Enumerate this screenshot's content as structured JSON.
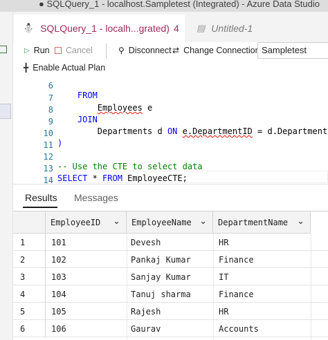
{
  "window": {
    "title": "● SQLQuery_1 - localhost.Sampletest (Integrated) - Azure Data Studio"
  },
  "tabs": [
    {
      "label": "SQLQuery_1 - localh...grated)",
      "count": "4",
      "active": true,
      "icon": "database-icon"
    },
    {
      "label": "Untitled-1",
      "active": false,
      "icon": "file-icon"
    }
  ],
  "toolbar": {
    "run_label": "Run",
    "cancel_label": "Cancel",
    "disconnect_label": "Disconnect",
    "change_connection_label": "Change Connection",
    "database_value": "Sampletest",
    "enable_plan_label": "Enable Actual Plan"
  },
  "editor": {
    "lines": [
      {
        "num": "6",
        "text": "    FROM"
      },
      {
        "num": "7",
        "text": "        Employees e"
      },
      {
        "num": "8",
        "text": "    JOIN"
      },
      {
        "num": "9",
        "text": "        Departments d ON e.DepartmentID = d.DepartmentID"
      },
      {
        "num": "10",
        "text": ")"
      },
      {
        "num": "11",
        "text": ""
      },
      {
        "num": "12",
        "text": "-- Use the CTE to select data"
      },
      {
        "num": "13",
        "text": "SELECT * FROM EmployeeCTE;"
      },
      {
        "num": "14",
        "text": ""
      }
    ]
  },
  "results": {
    "tabs": [
      "Results",
      "Messages"
    ],
    "columns": [
      "EmployeeID",
      "EmployeeName",
      "DepartmentName"
    ],
    "rows": [
      {
        "n": "1",
        "cells": [
          "101",
          "Devesh",
          "HR"
        ]
      },
      {
        "n": "2",
        "cells": [
          "102",
          "Pankaj Kumar",
          "Finance"
        ]
      },
      {
        "n": "3",
        "cells": [
          "103",
          "Sanjay Kumar",
          "IT"
        ]
      },
      {
        "n": "4",
        "cells": [
          "104",
          "Tanuj sharma",
          "Finance"
        ]
      },
      {
        "n": "5",
        "cells": [
          "105",
          "Rajesh",
          "HR"
        ]
      },
      {
        "n": "6",
        "cells": [
          "106",
          "Gaurav",
          "Accounts"
        ]
      }
    ]
  },
  "colors": {
    "active_tab_text": "#a0295a",
    "keyword": "#0000ff",
    "comment": "#008000",
    "line_number": "#237893",
    "run_icon": "#2f8f3f"
  }
}
